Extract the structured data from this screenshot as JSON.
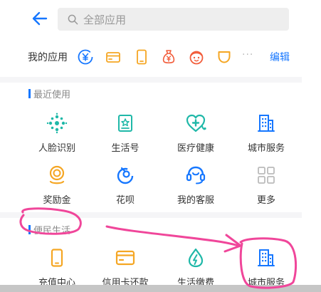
{
  "search": {
    "placeholder": "全部应用"
  },
  "my_apps": {
    "label": "我的应用",
    "edit_label": "编辑",
    "more_dots": "···",
    "icons": [
      "yuebao-icon",
      "card-icon",
      "phone-recharge-icon",
      "money-bag-icon",
      "avatar-face-icon",
      "cup-icon"
    ]
  },
  "recent": {
    "title": "最近使用",
    "items": [
      {
        "label": "人脸识别",
        "icon": "face-scan-icon"
      },
      {
        "label": "生活号",
        "icon": "star-badge-icon"
      },
      {
        "label": "医疗健康",
        "icon": "heart-health-icon"
      },
      {
        "label": "城市服务",
        "icon": "building-icon"
      },
      {
        "label": "奖励金",
        "icon": "reward-coin-icon"
      },
      {
        "label": "花呗",
        "icon": "huabei-icon"
      },
      {
        "label": "我的客服",
        "icon": "headset-icon"
      },
      {
        "label": "更多",
        "icon": "grid-more-icon"
      }
    ]
  },
  "convenience": {
    "title": "便民生活",
    "items": [
      {
        "label": "充值中心",
        "icon": "phone-recharge-icon"
      },
      {
        "label": "信用卡还款",
        "icon": "credit-card-icon"
      },
      {
        "label": "生活缴费",
        "icon": "water-drop-icon"
      },
      {
        "label": "城市服务",
        "icon": "building-icon"
      }
    ]
  },
  "colors": {
    "accent": "#1677ff",
    "orange": "#f5a623",
    "red": "#f25c3a",
    "annotation": "#f0469a"
  }
}
